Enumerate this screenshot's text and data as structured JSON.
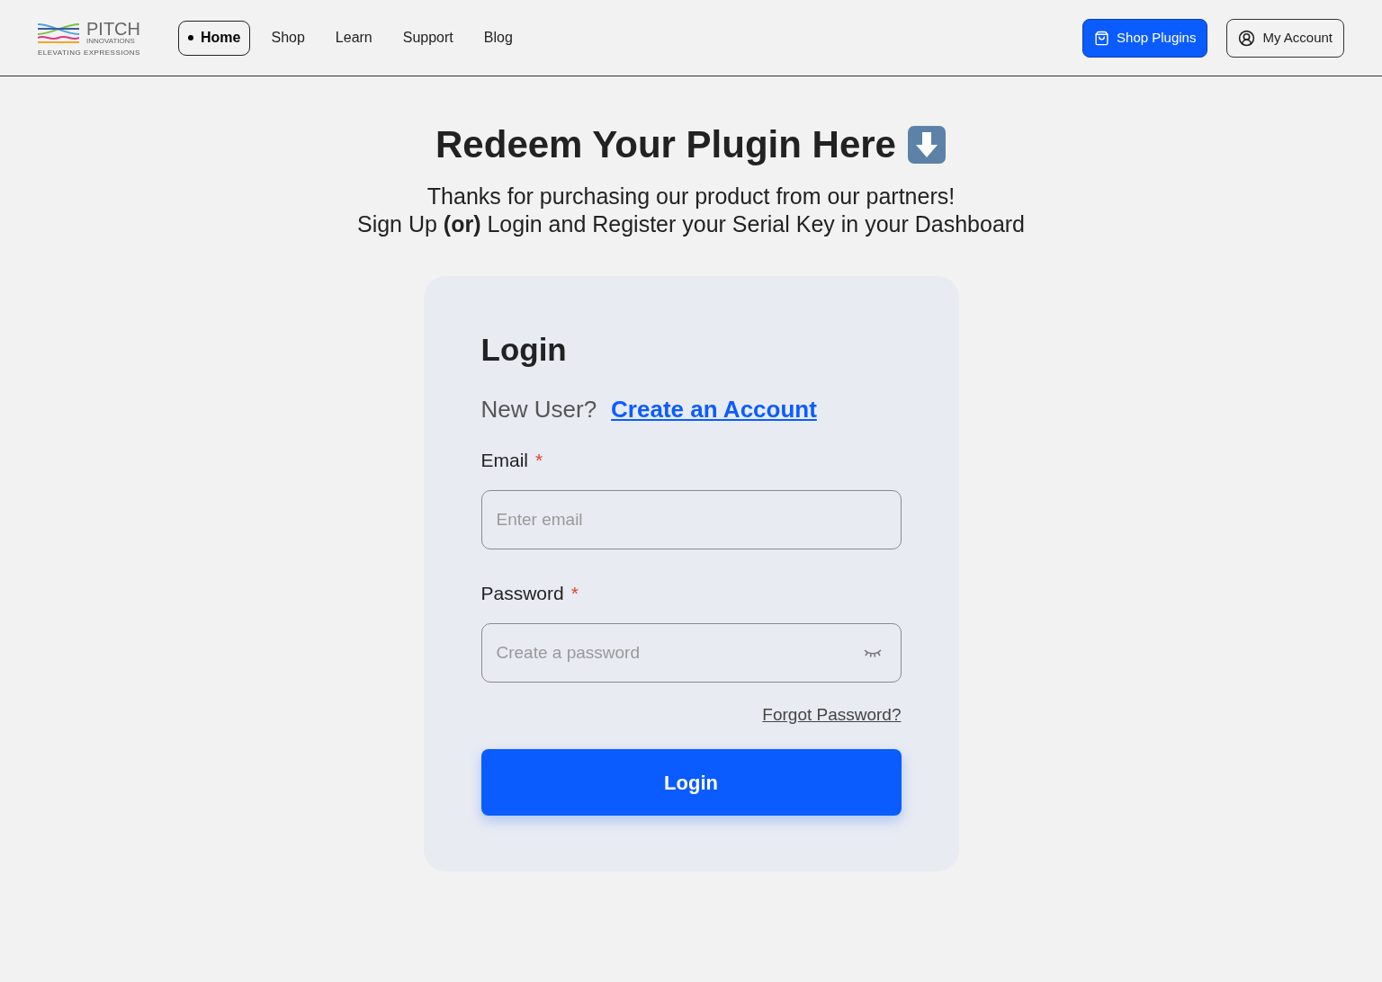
{
  "logo": {
    "name": "PITCH",
    "subtitle": "INNOVATIONS",
    "tagline": "ELEVATING EXPRESSIONS"
  },
  "nav": [
    {
      "label": "Home",
      "selected": true
    },
    {
      "label": "Shop",
      "selected": false
    },
    {
      "label": "Learn",
      "selected": false
    },
    {
      "label": "Support",
      "selected": false
    },
    {
      "label": "Blog",
      "selected": false
    }
  ],
  "header_buttons": [
    {
      "kind": "primary",
      "label": "Shop Plugins"
    },
    {
      "kind": "outline",
      "label": "My Account"
    }
  ],
  "title": "Redeem Your Plugin Here",
  "intro": [
    "Thanks for purchasing our product from our partners!",
    "Sign Up **(or)** Login and Register your Serial Key in your Dashboard"
  ],
  "form": {
    "title": "Login",
    "new_user": "New User?",
    "create_link": "Create an Account",
    "fields": [
      {
        "label": "Email",
        "required": true,
        "required_mark": "*",
        "placeholder": "Enter email",
        "kind": "email"
      },
      {
        "label": "Password",
        "required": true,
        "required_mark": "*",
        "placeholder": "Create a password",
        "kind": "password"
      }
    ],
    "forgot": "Forgot Password?",
    "submit": "Login"
  }
}
